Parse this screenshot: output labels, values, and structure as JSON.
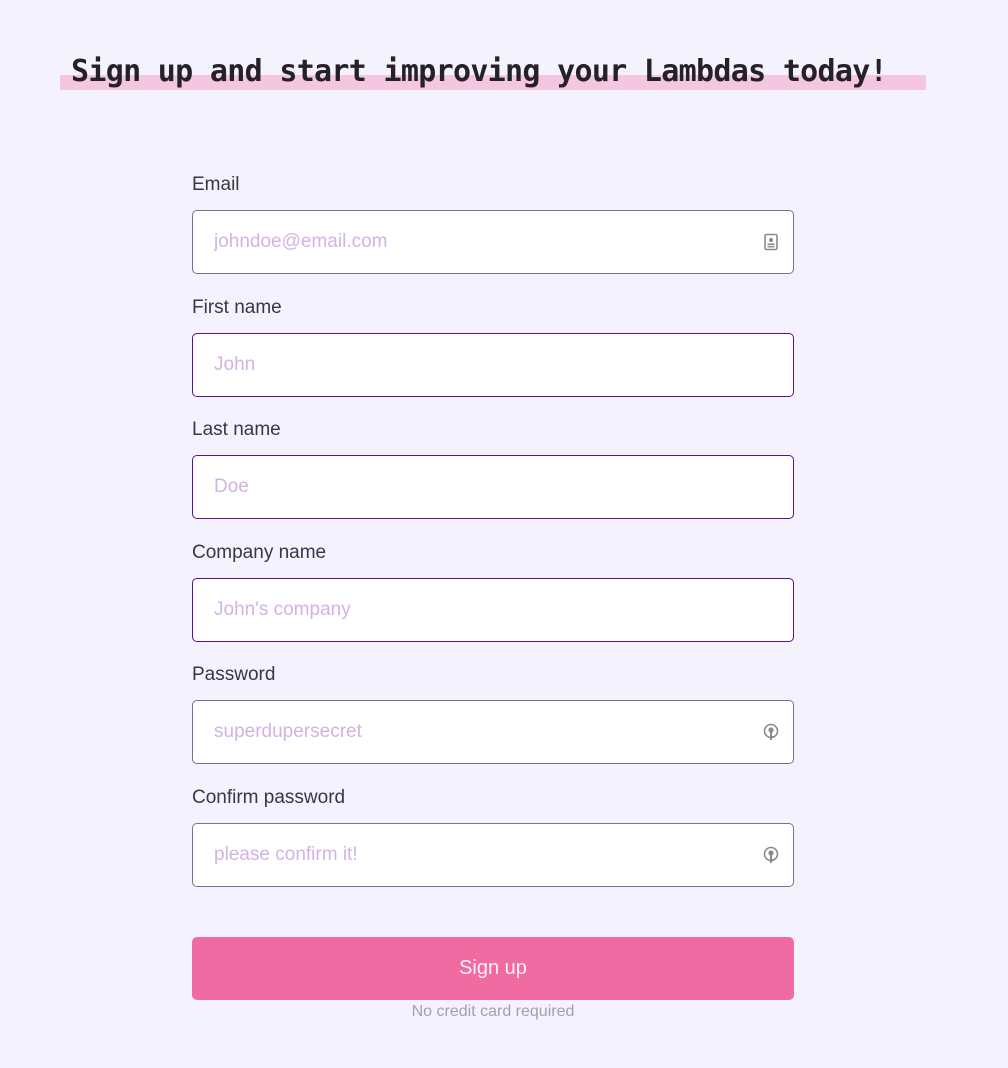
{
  "heading": "Sign up and start improving your Lambdas today!",
  "form": {
    "fields": [
      {
        "label": "Email",
        "placeholder": "johndoe@email.com",
        "icon": "contact-card-icon"
      },
      {
        "label": "First name",
        "placeholder": "John"
      },
      {
        "label": "Last name",
        "placeholder": "Doe"
      },
      {
        "label": "Company name",
        "placeholder": "John's company"
      },
      {
        "label": "Password",
        "placeholder": "superdupersecret",
        "icon": "key-icon"
      },
      {
        "label": "Confirm password",
        "placeholder": "please confirm it!",
        "icon": "key-icon"
      }
    ],
    "submit_label": "Sign up",
    "note": "No credit card required"
  },
  "colors": {
    "background": "#f4f2fc",
    "highlight": "#f5c6e0",
    "button": "#f06ba2",
    "input_border": "#5b118f",
    "placeholder": "#d2b3e3"
  }
}
